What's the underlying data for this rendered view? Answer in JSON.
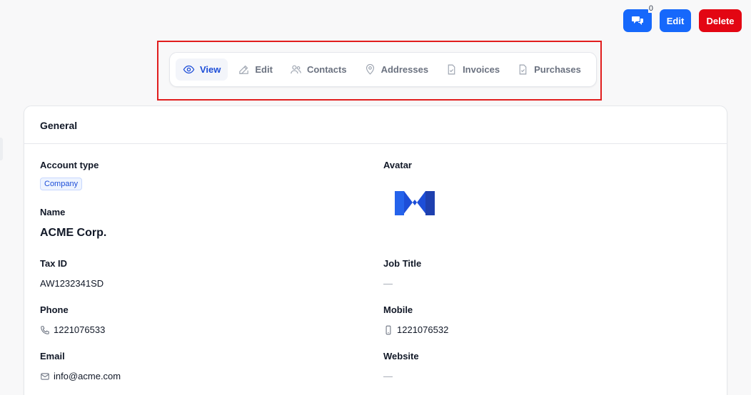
{
  "actions": {
    "comments_count": "0",
    "edit_label": "Edit",
    "delete_label": "Delete"
  },
  "tabs": [
    {
      "label": "View",
      "icon": "eye-icon",
      "active": true
    },
    {
      "label": "Edit",
      "icon": "pencil-square-icon",
      "active": false
    },
    {
      "label": "Contacts",
      "icon": "users-icon",
      "active": false
    },
    {
      "label": "Addresses",
      "icon": "map-pin-icon",
      "active": false
    },
    {
      "label": "Invoices",
      "icon": "document-check-icon",
      "active": false
    },
    {
      "label": "Purchases",
      "icon": "document-check-icon",
      "active": false
    }
  ],
  "card": {
    "title": "General",
    "fields": {
      "account_type": {
        "label": "Account type",
        "value": "Company"
      },
      "avatar": {
        "label": "Avatar"
      },
      "name": {
        "label": "Name",
        "value": "ACME Corp."
      },
      "tax_id": {
        "label": "Tax ID",
        "value": "AW1232341SD"
      },
      "job_title": {
        "label": "Job Title",
        "value": "—"
      },
      "phone": {
        "label": "Phone",
        "value": "1221076533"
      },
      "mobile": {
        "label": "Mobile",
        "value": "1221076532"
      },
      "email": {
        "label": "Email",
        "value": "info@acme.com"
      },
      "website": {
        "label": "Website",
        "value": "—"
      }
    }
  },
  "colors": {
    "primary": "#1668fb",
    "danger": "#e30613",
    "highlight": "#e11d1d",
    "logo": "#1d4ed8"
  }
}
